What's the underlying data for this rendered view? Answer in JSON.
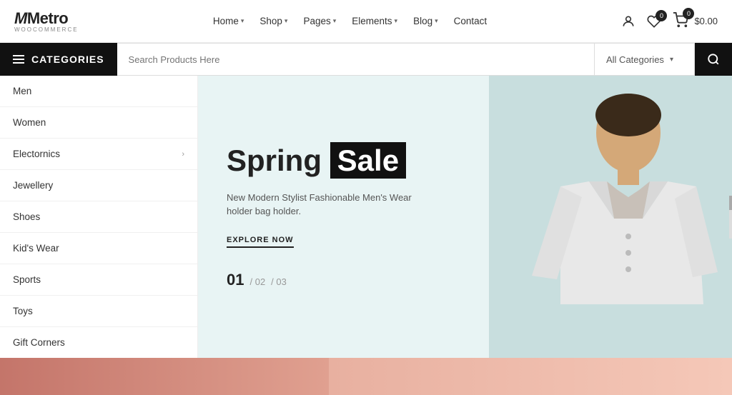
{
  "logo": {
    "name": "Metro",
    "sub": "WOOCOMMERCE"
  },
  "nav": {
    "items": [
      {
        "label": "Home",
        "hasDropdown": true
      },
      {
        "label": "Shop",
        "hasDropdown": true
      },
      {
        "label": "Pages",
        "hasDropdown": true
      },
      {
        "label": "Elements",
        "hasDropdown": true
      },
      {
        "label": "Blog",
        "hasDropdown": true
      },
      {
        "label": "Contact",
        "hasDropdown": false
      }
    ]
  },
  "header_icons": {
    "wishlist_count": "0",
    "cart_count": "0",
    "cart_total": "$0.00"
  },
  "search": {
    "placeholder": "Search Products Here",
    "category_label": "All Categories"
  },
  "sidebar": {
    "header_label": "CATEGORIES",
    "items": [
      {
        "label": "Men",
        "has_arrow": false
      },
      {
        "label": "Women",
        "has_arrow": false
      },
      {
        "label": "Electornics",
        "has_arrow": true
      },
      {
        "label": "Jewellery",
        "has_arrow": false
      },
      {
        "label": "Shoes",
        "has_arrow": false
      },
      {
        "label": "Kid's Wear",
        "has_arrow": false
      },
      {
        "label": "Sports",
        "has_arrow": false
      },
      {
        "label": "Toys",
        "has_arrow": false
      },
      {
        "label": "Gift Corners",
        "has_arrow": false
      }
    ]
  },
  "hero": {
    "title_part1": "Spring",
    "title_part2": "Sale",
    "subtitle": "New Modern Stylist Fashionable Men's Wear\nholder bag holder.",
    "cta_label": "EXPLORE NOW",
    "slide_current": "01",
    "slide_sep1": "/ 02",
    "slide_sep2": "/ 03"
  }
}
